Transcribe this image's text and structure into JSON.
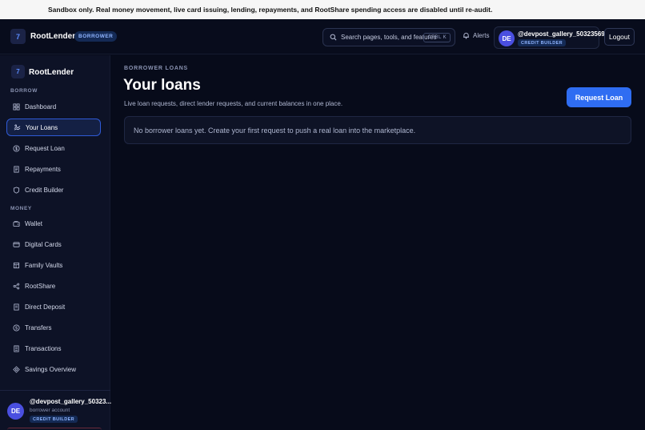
{
  "banner": {
    "text": "Sandbox only. Real money movement, live card issuing, lending, repayments, and RootShare spending access are disabled until re-audit."
  },
  "header": {
    "logo_glyph": "7",
    "brand": "RootLender",
    "role_badge": "BORROWER",
    "search_placeholder": "Search pages, tools, and features",
    "search_shortcut": "CTRL K",
    "alerts_label": "Alerts",
    "user": {
      "initials": "DE",
      "username": "@devpost_gallery_50323569",
      "badge": "CREDIT BUILDER"
    },
    "logout_label": "Logout"
  },
  "sidebar": {
    "logo_glyph": "7",
    "brand": "RootLender",
    "sections": [
      {
        "title": "BORROW",
        "items": [
          {
            "label": "Dashboard",
            "icon": "dashboard-icon"
          },
          {
            "label": "Your Loans",
            "icon": "loans-icon",
            "active": true
          },
          {
            "label": "Request Loan",
            "icon": "dollar-circle-icon"
          },
          {
            "label": "Repayments",
            "icon": "receipt-icon"
          },
          {
            "label": "Credit Builder",
            "icon": "shield-icon"
          }
        ]
      },
      {
        "title": "MONEY",
        "items": [
          {
            "label": "Wallet",
            "icon": "wallet-icon"
          },
          {
            "label": "Digital Cards",
            "icon": "card-icon"
          },
          {
            "label": "Family Vaults",
            "icon": "vault-icon"
          },
          {
            "label": "RootShare",
            "icon": "share-icon"
          },
          {
            "label": "Direct Deposit",
            "icon": "document-icon"
          },
          {
            "label": "Transfers",
            "icon": "transfer-icon"
          },
          {
            "label": "Transactions",
            "icon": "list-icon"
          },
          {
            "label": "Savings Overview",
            "icon": "savings-icon"
          }
        ]
      }
    ],
    "footer": {
      "initials": "DE",
      "username": "@devpost_gallery_50323...",
      "role": "borrower account",
      "badge": "CREDIT BUILDER"
    }
  },
  "main": {
    "eyebrow": "BORROWER LOANS",
    "title": "Your loans",
    "subtitle": "Live loan requests, direct lender requests, and current balances in one place.",
    "request_button": "Request Loan",
    "empty_message": "No borrower loans yet. Create your first request to push a real loan into the marketplace."
  },
  "colors": {
    "accent": "#2f6df2",
    "background": "#070b1a",
    "sidebar": "#0d1226",
    "avatar": "#4a4fe0"
  }
}
